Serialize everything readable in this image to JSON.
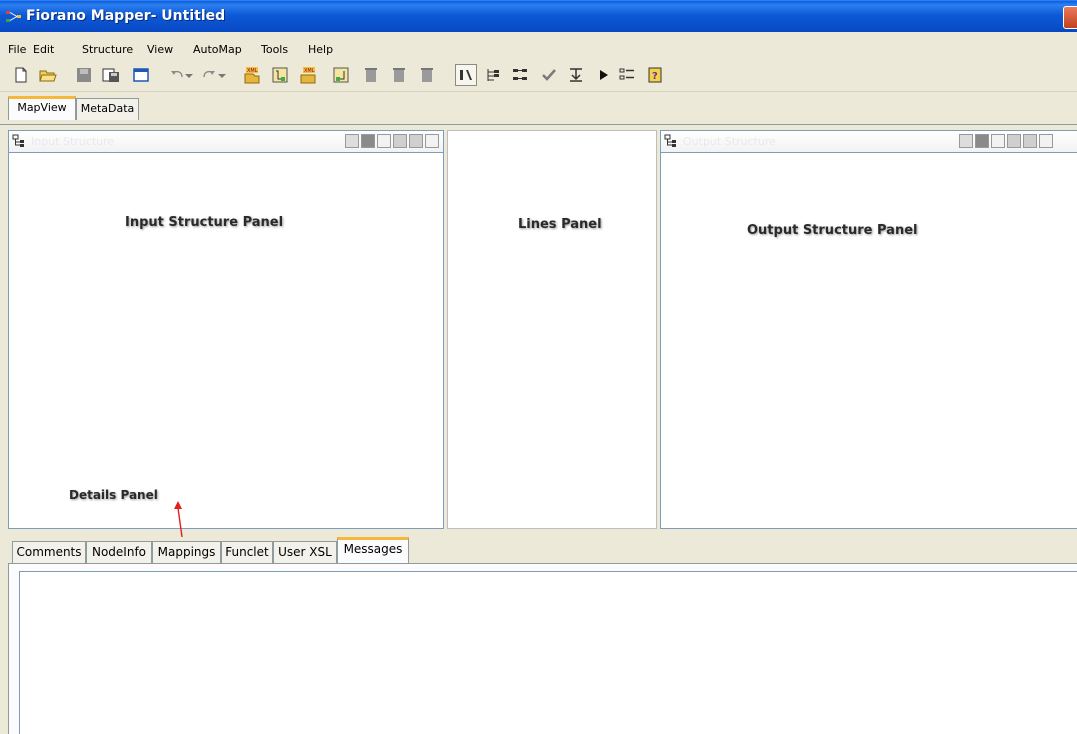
{
  "window": {
    "title": "Fiorano Mapper- Untitled"
  },
  "menu": [
    "File",
    "Edit",
    "Structure",
    "View",
    "AutoMap",
    "Tools",
    "Help"
  ],
  "toolbar": {
    "icons": [
      "new-file-icon",
      "open-folder-icon",
      "save-icon",
      "save-as-icon",
      "window-icon",
      "undo-icon",
      "undo-dropdown-icon",
      "redo-icon",
      "redo-dropdown-icon",
      "load-xml-icon",
      "structure-icon",
      "export-xml-icon",
      "import-structure-icon",
      "delete-icon",
      "delete-all-icon",
      "node-view-icon",
      "tree-expand-icon",
      "tree-collapse-icon",
      "validate-icon",
      "mapping-icon",
      "run-icon",
      "list-icon",
      "help-icon"
    ]
  },
  "main_tabs": [
    "MapView",
    "MetaData"
  ],
  "panels": {
    "input": {
      "header": "Input Structure",
      "label": "Input Structure Panel"
    },
    "lines": {
      "label": "Lines Panel"
    },
    "output": {
      "header": "Output Structure",
      "label": "Output Structure Panel"
    }
  },
  "details_label": "Details Panel",
  "bottom_tabs": [
    "Comments",
    "NodeInfo",
    "Mappings",
    "Funclet",
    "User XSL",
    "Messages"
  ],
  "colors": {
    "titlebar": "#0a5fd8",
    "active_tab": "#f5b83d",
    "arrow": "#e02020"
  }
}
